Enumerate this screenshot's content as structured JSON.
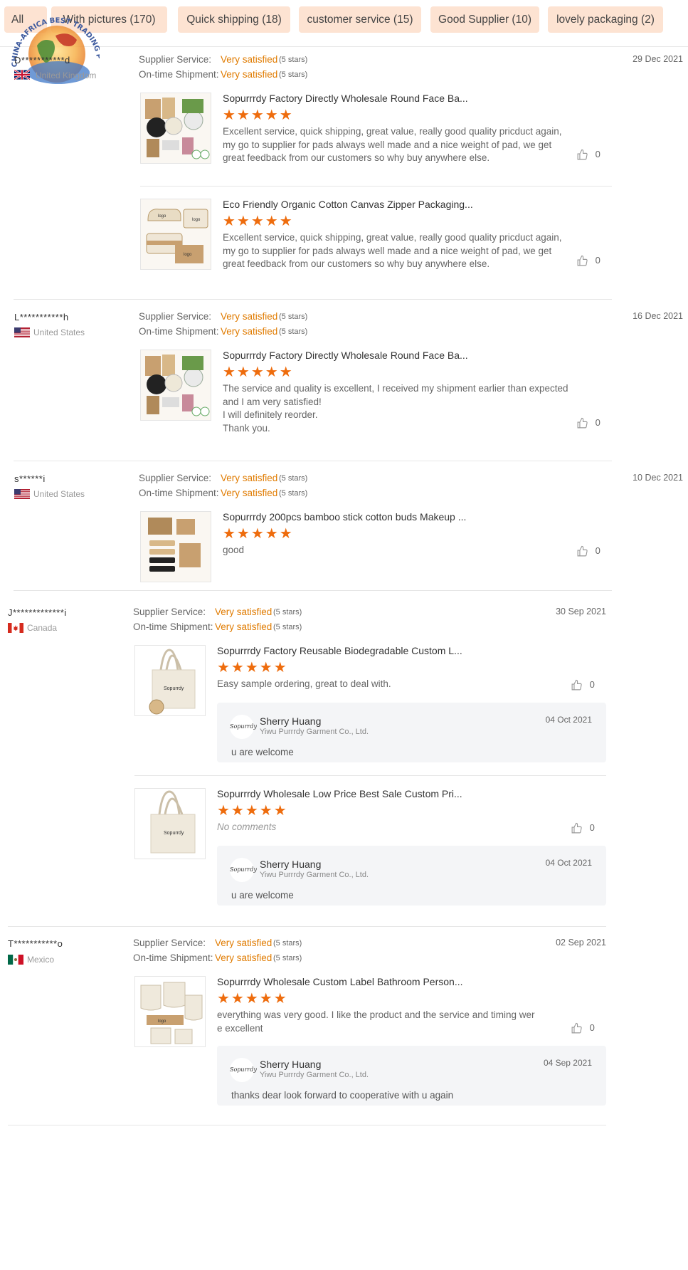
{
  "tabs": [
    {
      "label": "All"
    },
    {
      "label": "With pictures (170)"
    },
    {
      "label": "Quick shipping (18)"
    },
    {
      "label": "customer service (15)"
    },
    {
      "label": "Good Supplier (10)"
    },
    {
      "label": "lovely packaging (2)"
    }
  ],
  "watermark": {
    "text": "CHINA-AFRICA BEST TRADING PLATFORM"
  },
  "labels": {
    "supplier_service": "Supplier Service:",
    "ontime_shipment": "On-time Shipment:",
    "very_satisfied": "Very satisfied",
    "five_stars": "(5 stars)",
    "star_glyphs": "★★★★★",
    "like_count": "0"
  },
  "reviews": [
    {
      "user": "D***********d",
      "country": "United Kingdom",
      "flag": "uk",
      "date": "29 Dec 2021",
      "items": [
        {
          "title": "Sopurrrdy Factory Directly Wholesale Round Face Ba...",
          "comment": "Excellent service, quick shipping, great value,  really good quality pricduct again, my go to supplier for pads always well made and a nice weight of pad, we get great feedback from our customers so why buy anywhere else.",
          "likes": "0"
        },
        {
          "title": "Eco Friendly Organic Cotton Canvas Zipper Packaging...",
          "comment": "Excellent service, quick shipping, great value,  really good quality pricduct again, my go to supplier for pads always well made and a nice weight of pad, we get great feedback from our customers so why buy anywhere else.",
          "likes": "0"
        }
      ]
    },
    {
      "user": "L***********h",
      "country": "United States",
      "flag": "us",
      "date": "16 Dec 2021",
      "items": [
        {
          "title": "Sopurrrdy Factory Directly Wholesale Round Face Ba...",
          "comment": "The service and quality is excellent, I received my shipment earlier than expected and I am very satisfied!\nI will definitely reorder.\nThank you.",
          "likes": "0"
        }
      ]
    },
    {
      "user": "s******i",
      "country": "United States",
      "flag": "us",
      "date": "10 Dec 2021",
      "items": [
        {
          "title": "Sopurrrdy 200pcs bamboo stick cotton buds Makeup ...",
          "comment": "good",
          "likes": "0"
        }
      ]
    },
    {
      "user": "J*************i",
      "country": "Canada",
      "flag": "ca",
      "date": "30 Sep 2021",
      "items": [
        {
          "title": "Sopurrrdy Factory Reusable Biodegradable Custom L...",
          "comment": "Easy sample ordering, great to deal with.",
          "likes": "0",
          "reply": {
            "name": "Sherry Huang",
            "company": "Yiwu Purrrdy Garment Co., Ltd.",
            "date": "04 Oct 2021",
            "text": "u are welcome"
          }
        },
        {
          "title": "Sopurrrdy Wholesale Low Price Best Sale Custom Pri...",
          "comment": "No comments",
          "likes": "0",
          "reply": {
            "name": "Sherry Huang",
            "company": "Yiwu Purrrdy Garment Co., Ltd.",
            "date": "04 Oct 2021",
            "text": "u are welcome"
          }
        }
      ]
    },
    {
      "user": "T***********o",
      "country": "Mexico",
      "flag": "mx",
      "date": "02 Sep 2021",
      "items": [
        {
          "title": "Sopurrrdy Wholesale Custom Label Bathroom Person...",
          "comment": "everything was very good. I like the product and the service and timing were excellent",
          "likes": "0",
          "reply": {
            "name": "Sherry Huang",
            "company": "Yiwu Purrrdy Garment Co., Ltd.",
            "date": "04 Sep 2021",
            "text": "thanks dear look forward to cooperative with u again"
          }
        }
      ]
    }
  ],
  "colors": {
    "accent": "#ee6c0d",
    "satisfied": "#e07b00",
    "tab_bg": "#fde3d2"
  }
}
